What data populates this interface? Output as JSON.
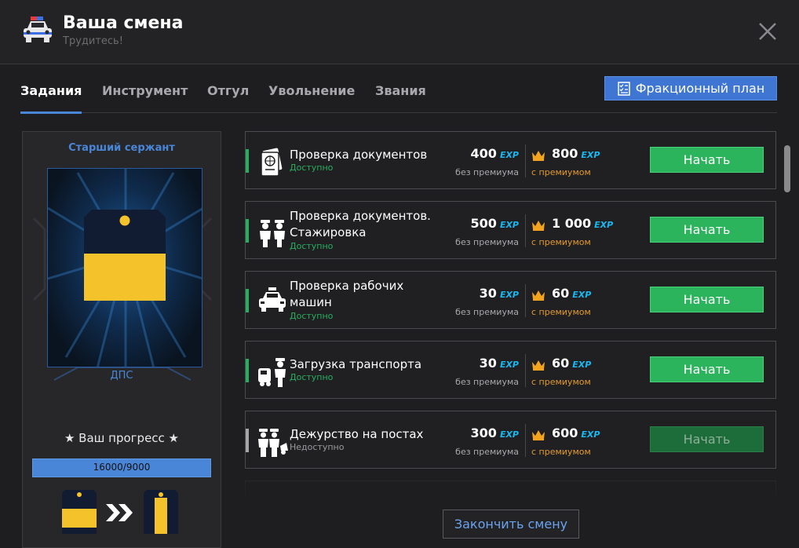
{
  "header": {
    "title": "Ваша смена",
    "subtitle": "Трудитесь!",
    "logo_icon": "police-car-icon",
    "close_icon": "close-icon"
  },
  "tabs": [
    {
      "label": "Задания",
      "active": true
    },
    {
      "label": "Инструмент",
      "active": false
    },
    {
      "label": "Отгул",
      "active": false
    },
    {
      "label": "Увольнение",
      "active": false
    },
    {
      "label": "Звания",
      "active": false
    }
  ],
  "plan_button": {
    "label": "Фракционный план",
    "icon": "checklist-icon"
  },
  "rank": {
    "title": "Старший сержант",
    "department": "ДПС",
    "progress_title": "★ Ваш прогресс ★",
    "progress_text": "16000/9000",
    "progress_fraction": 1.0
  },
  "tasks": [
    {
      "name": "Проверка документов",
      "status": "Доступно",
      "locked": false,
      "icon": "passport-icon",
      "reward_base": "400",
      "reward_base_note": "без премиума",
      "reward_premium": "800",
      "reward_premium_note": "с премиумом",
      "exp": "EXP",
      "button": "Начать"
    },
    {
      "name": "Проверка документов. Стажировка",
      "status": "Доступно",
      "locked": false,
      "icon": "officers-icon",
      "reward_base": "500",
      "reward_base_note": "без премиума",
      "reward_premium": "1 000",
      "reward_premium_note": "с премиумом",
      "exp": "EXP",
      "button": "Начать"
    },
    {
      "name": "Проверка рабочих машин",
      "status": "Доступно",
      "locked": false,
      "icon": "police-car-icon",
      "reward_base": "30",
      "reward_base_note": "без премиума",
      "reward_premium": "60",
      "reward_premium_note": "с премиумом",
      "exp": "EXP",
      "button": "Начать"
    },
    {
      "name": "Загрузка транспорта",
      "status": "Доступно",
      "locked": false,
      "icon": "tow-officer-icon",
      "reward_base": "30",
      "reward_base_note": "без премиума",
      "reward_premium": "60",
      "reward_premium_note": "с премиумом",
      "exp": "EXP",
      "button": "Начать"
    },
    {
      "name": "Дежурство на постах",
      "status": "Недоступно",
      "locked": true,
      "icon": "checkpoint-officers-icon",
      "reward_base": "300",
      "reward_base_note": "без премиума",
      "reward_premium": "600",
      "reward_premium_note": "с премиумом",
      "exp": "EXP",
      "button": "Начать"
    }
  ],
  "finish_button": "Закончить смену",
  "colors": {
    "accent": "#4a86d8",
    "start": "#2bb45c",
    "exp": "#19b8f0",
    "premium": "#e29a2e",
    "badge": "#f4c22b"
  }
}
